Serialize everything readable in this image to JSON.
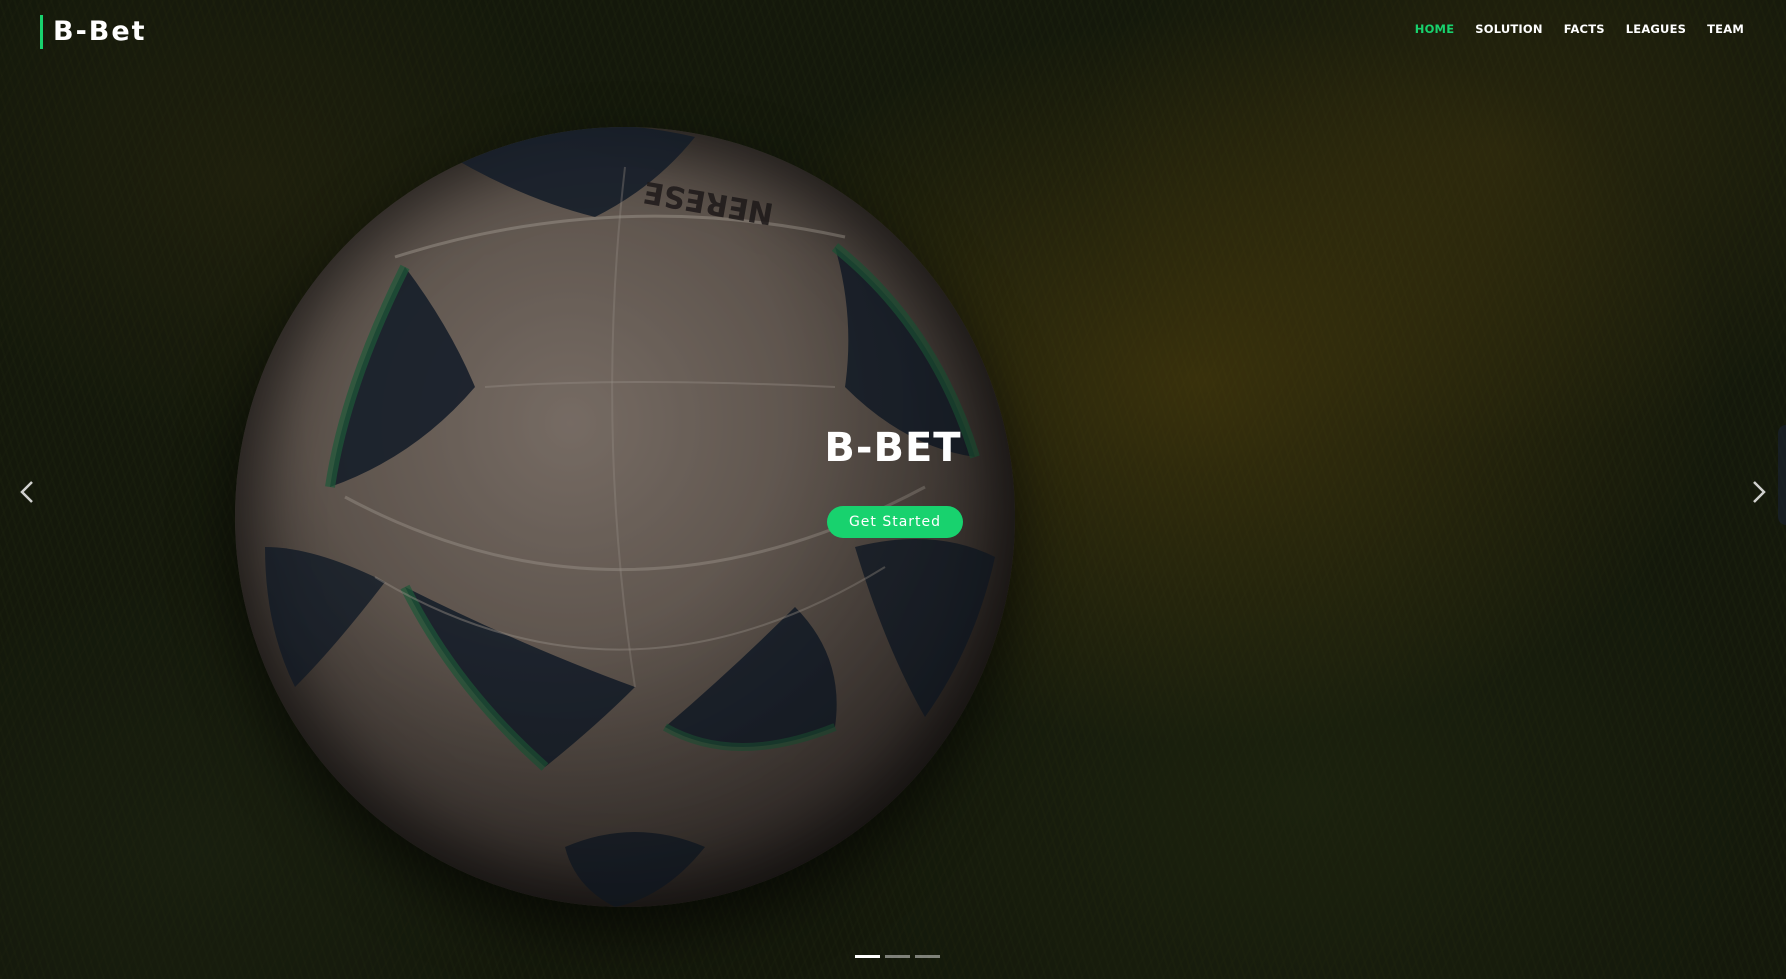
{
  "brand": {
    "logo_text": "B-Bet",
    "accent_color": "#18d26e"
  },
  "nav": {
    "items": [
      {
        "label": "HOME",
        "active": true
      },
      {
        "label": "SOLUTION",
        "active": false
      },
      {
        "label": "FACTS",
        "active": false
      },
      {
        "label": "LEAGUES",
        "active": false
      },
      {
        "label": "TEAM",
        "active": false
      }
    ]
  },
  "hero": {
    "title": "B-BET",
    "cta_label": "Get Started",
    "background": "night-grass-soccer-ball-photo",
    "prev_icon": "chevron-left-icon",
    "next_icon": "chevron-right-icon",
    "slides_total": 3,
    "active_slide": 1
  }
}
